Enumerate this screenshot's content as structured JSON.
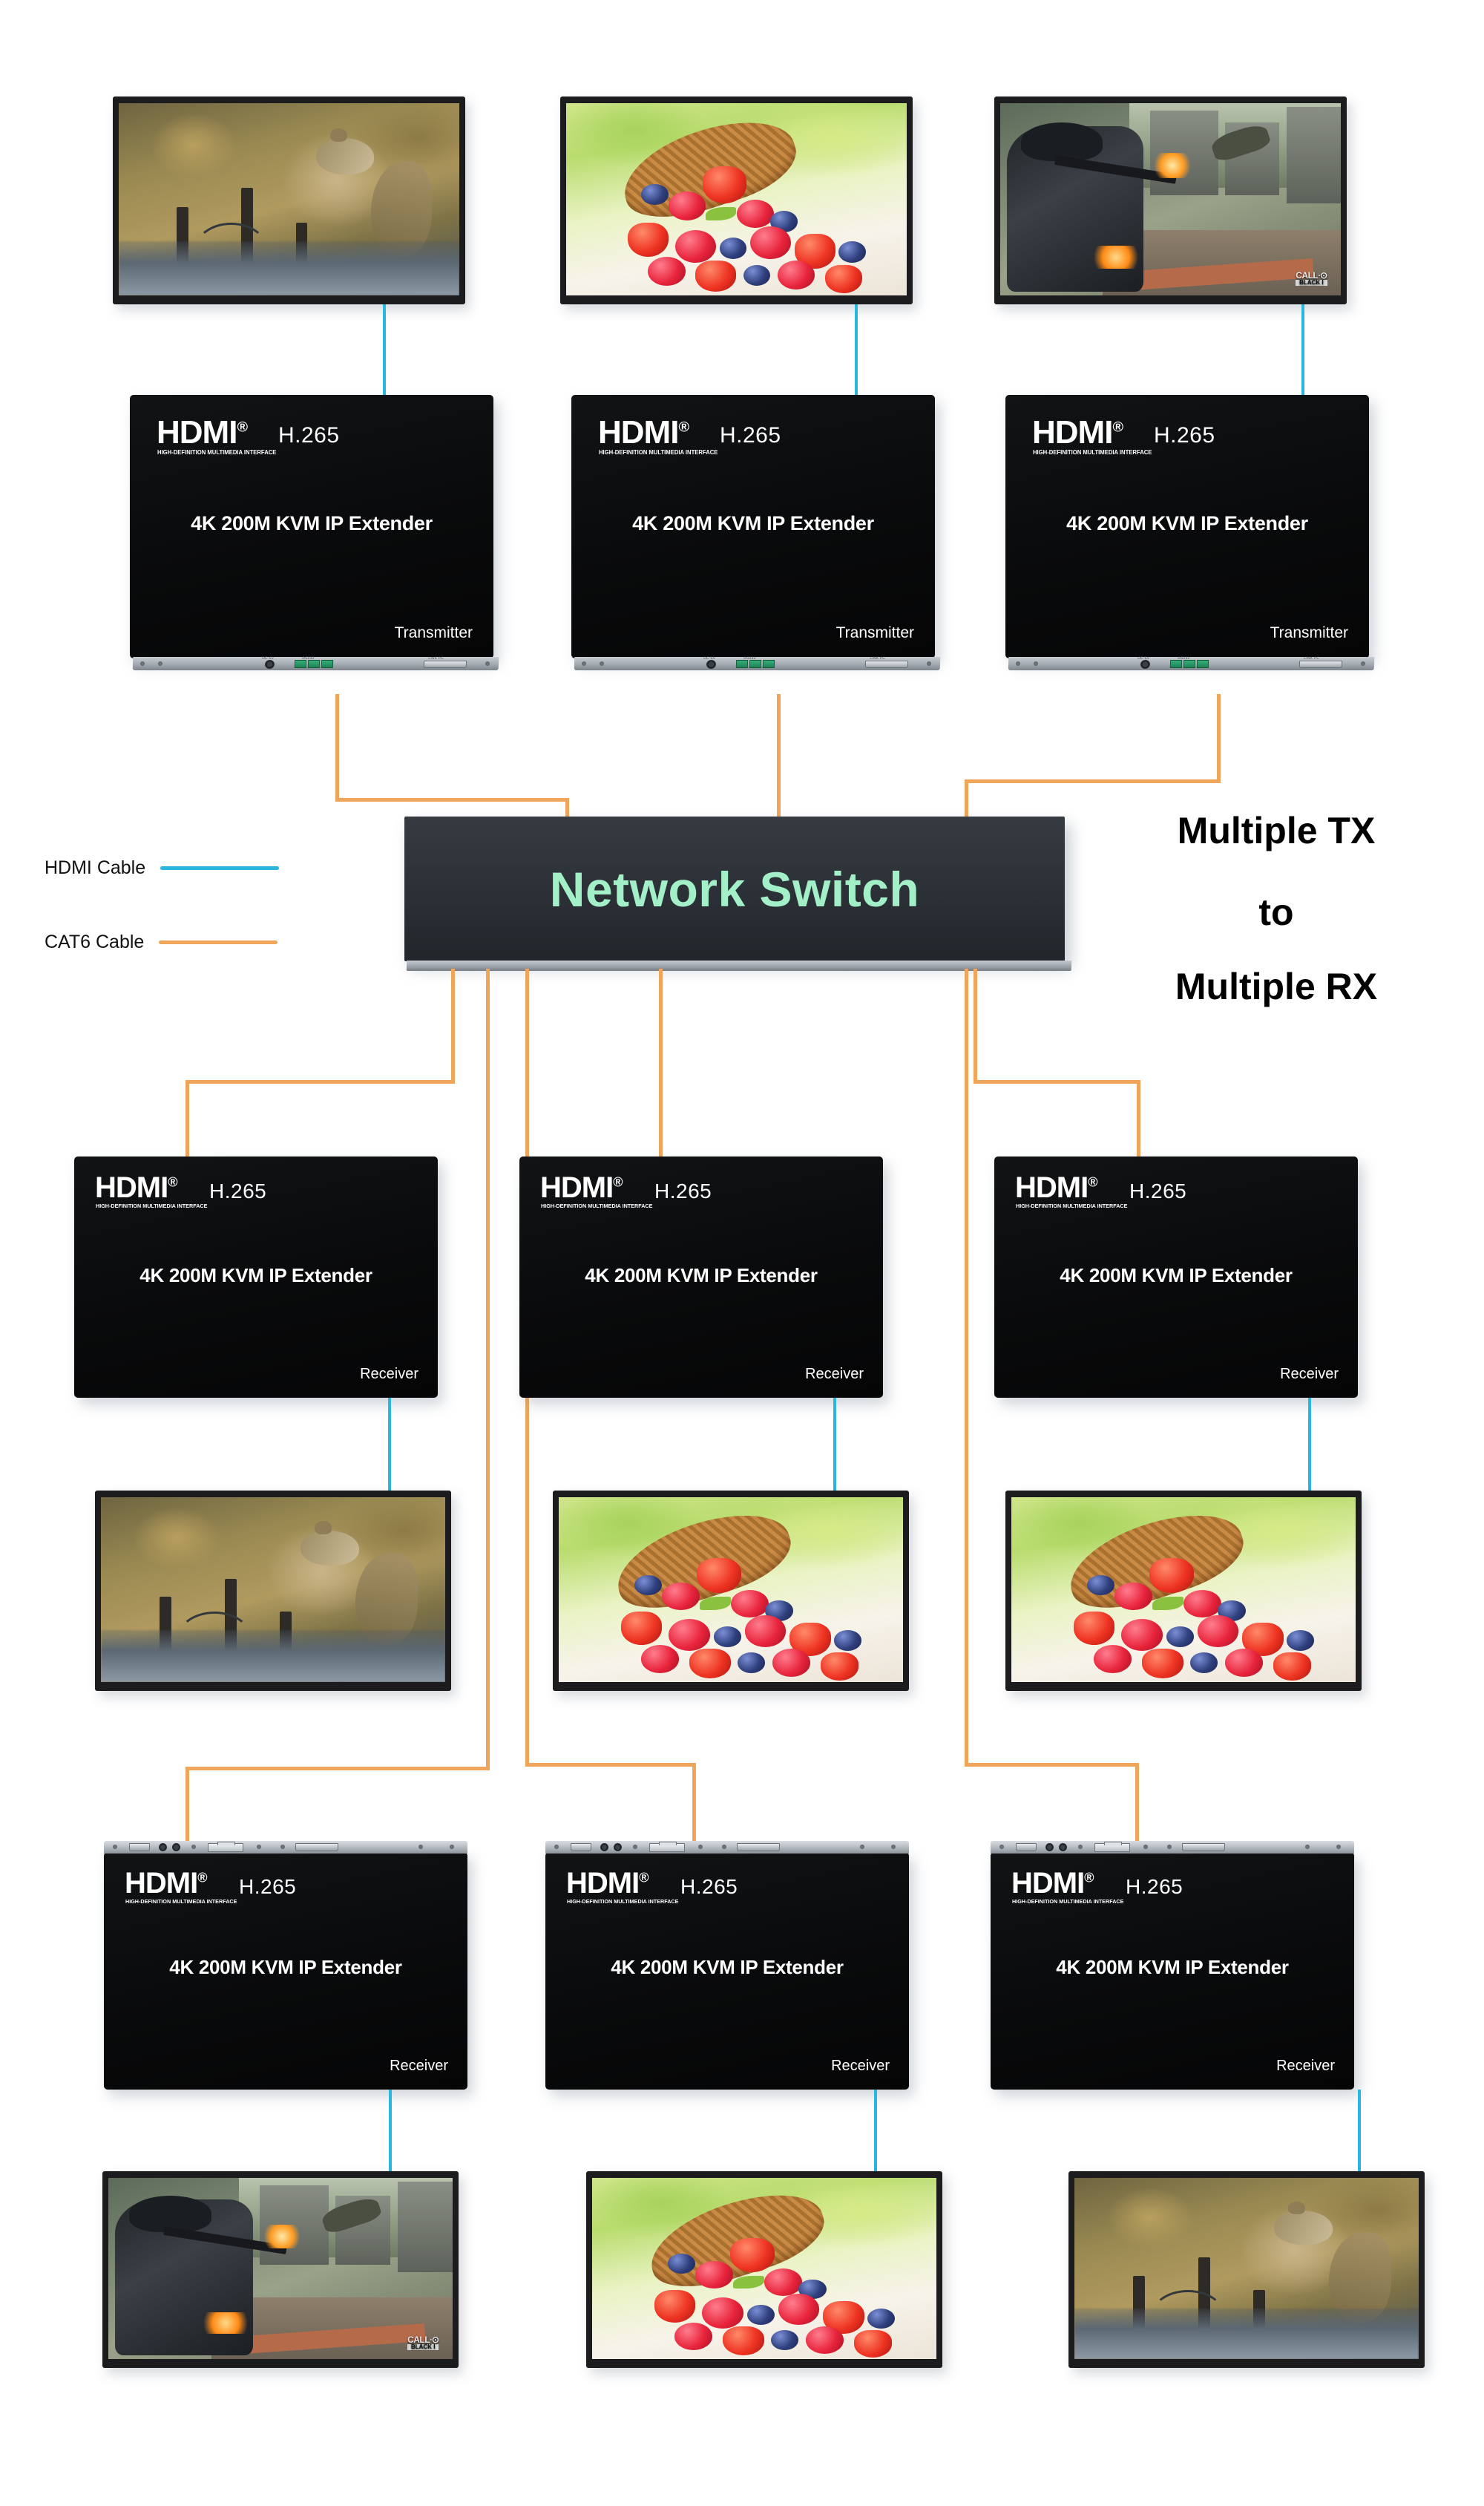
{
  "diagram": {
    "title_lines": [
      "Multiple TX",
      "to",
      "Multiple RX"
    ],
    "accent_cat6": "#f0a65a",
    "accent_hdmi": "#2ab6dd",
    "switch_text_color": "#a3f0c8",
    "switch_body_color": "#2b3036",
    "device_body_color": "#0a0b0c"
  },
  "legend": {
    "items": [
      {
        "label": "HDMI Cable",
        "color": "#2ab6dd"
      },
      {
        "label": "CAT6 Cable",
        "color": "#f0a65a"
      }
    ]
  },
  "network_switch": {
    "label": "Network Switch"
  },
  "device_common": {
    "brand": "HDMI",
    "brand_registered": "®",
    "brand_subtitle": "HIGH-DEFINITION MULTIMEDIA INTERFACE",
    "codec": "H.265",
    "model": "4K 200M KVM IP Extender",
    "port_labels": {
      "dc": "DC-5V",
      "rs232": "RS232",
      "link": "LINK PC"
    }
  },
  "transmitters": [
    {
      "id": "tx1",
      "role": "Transmitter",
      "model": "4K 200M KVM IP Extender",
      "codec": "H.265"
    },
    {
      "id": "tx2",
      "role": "Transmitter",
      "model": "4K 200M KVM IP Extender",
      "codec": "H.265"
    },
    {
      "id": "tx3",
      "role": "Transmitter",
      "model": "4K 200M KVM IP Extender",
      "codec": "H.265"
    }
  ],
  "receivers_row1": [
    {
      "id": "rx1",
      "role": "Receiver",
      "model": "4K 200M KVM IP Extender",
      "codec": "H.265"
    },
    {
      "id": "rx2",
      "role": "Receiver",
      "model": "4K 200M KVM IP Extender",
      "codec": "H.265"
    },
    {
      "id": "rx3",
      "role": "Receiver",
      "model": "4K 200M KVM IP Extender",
      "codec": "H.265"
    }
  ],
  "receivers_row2": [
    {
      "id": "rx4",
      "role": "Receiver",
      "model": "4K 200M KVM IP Extender",
      "codec": "H.265"
    },
    {
      "id": "rx5",
      "role": "Receiver",
      "model": "4K 200M KVM IP Extender",
      "codec": "H.265"
    },
    {
      "id": "rx6",
      "role": "Receiver",
      "model": "4K 200M KVM IP Extender",
      "codec": "H.265"
    }
  ],
  "monitors": {
    "top_row": [
      {
        "id": "src-mon-1",
        "content": "squirrel"
      },
      {
        "id": "src-mon-2",
        "content": "berries"
      },
      {
        "id": "src-mon-3",
        "content": "game"
      }
    ],
    "middle_row": [
      {
        "id": "out-mon-1",
        "content": "squirrel"
      },
      {
        "id": "out-mon-2",
        "content": "berries"
      },
      {
        "id": "out-mon-3",
        "content": "berries"
      }
    ],
    "bottom_row": [
      {
        "id": "out-mon-4",
        "content": "game"
      },
      {
        "id": "out-mon-5",
        "content": "berries"
      },
      {
        "id": "out-mon-6",
        "content": "squirrel"
      }
    ]
  },
  "game_logo": {
    "line1": "CALL∙⊙",
    "line2": "BLACK Ⅰ"
  }
}
